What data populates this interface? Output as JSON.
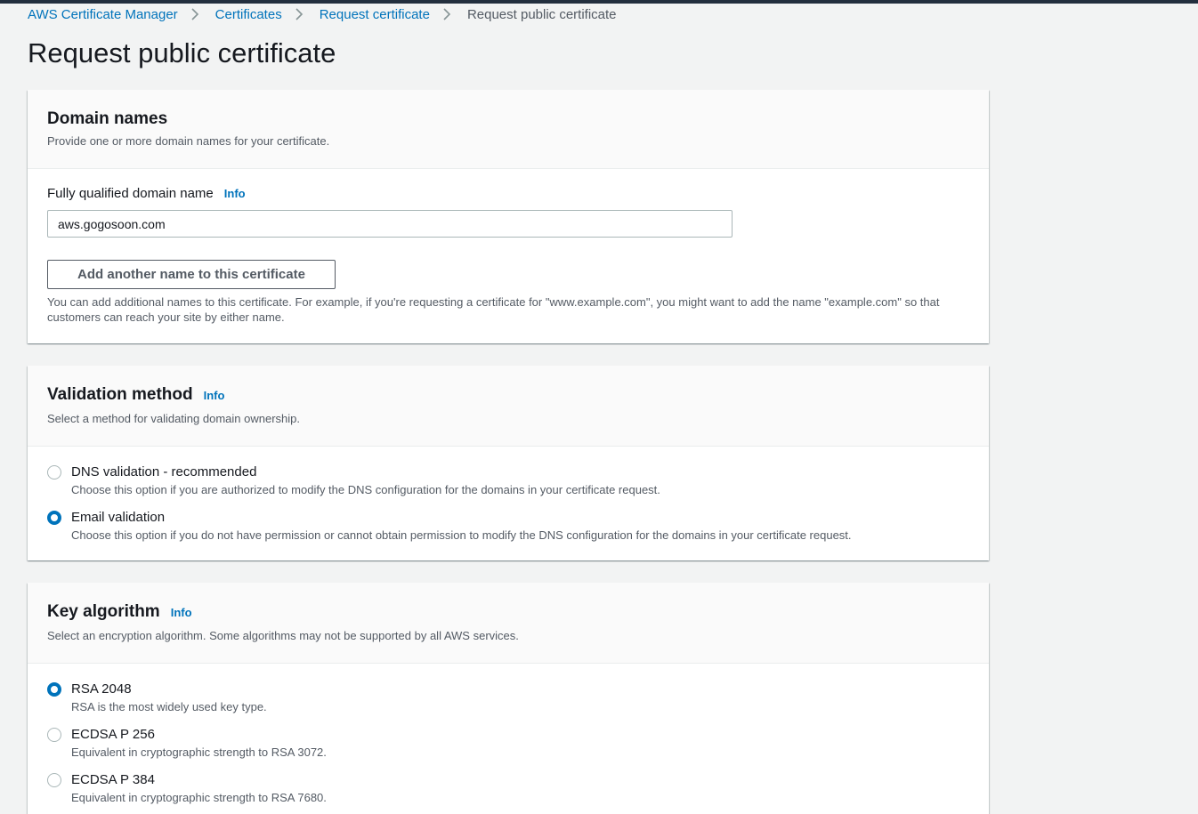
{
  "breadcrumb": {
    "items": [
      "AWS Certificate Manager",
      "Certificates",
      "Request certificate"
    ],
    "current": "Request public certificate"
  },
  "page": {
    "title": "Request public certificate"
  },
  "domain_names": {
    "title": "Domain names",
    "description": "Provide one or more domain names for your certificate.",
    "field_label": "Fully qualified domain name",
    "info": "Info",
    "field_value": "aws.gogosoon.com",
    "add_button": "Add another name to this certificate",
    "help_text": "You can add additional names to this certificate. For example, if you're requesting a certificate for \"www.example.com\", you might want to add the name \"example.com\" so that customers can reach your site by either name."
  },
  "validation_method": {
    "title": "Validation method",
    "info": "Info",
    "description": "Select a method for validating domain ownership.",
    "options": [
      {
        "label": "DNS validation - recommended",
        "description": "Choose this option if you are authorized to modify the DNS configuration for the domains in your certificate request.",
        "selected": false
      },
      {
        "label": "Email validation",
        "description": "Choose this option if you do not have permission or cannot obtain permission to modify the DNS configuration for the domains in your certificate request.",
        "selected": true
      }
    ]
  },
  "key_algorithm": {
    "title": "Key algorithm",
    "info": "Info",
    "description": "Select an encryption algorithm. Some algorithms may not be supported by all AWS services.",
    "options": [
      {
        "label": "RSA 2048",
        "description": "RSA is the most widely used key type.",
        "selected": true
      },
      {
        "label": "ECDSA P 256",
        "description": "Equivalent in cryptographic strength to RSA 3072.",
        "selected": false
      },
      {
        "label": "ECDSA P 384",
        "description": "Equivalent in cryptographic strength to RSA 7680.",
        "selected": false
      }
    ]
  },
  "colors": {
    "link": "#0073bb",
    "background": "#f2f3f3",
    "topbar": "#232f3e"
  }
}
